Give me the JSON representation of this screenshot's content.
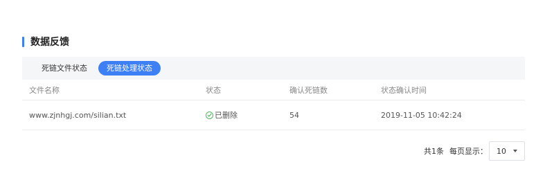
{
  "section": {
    "title": "数据反馈"
  },
  "tabs": [
    {
      "label": "死链文件状态",
      "active": false
    },
    {
      "label": "死链处理状态",
      "active": true
    }
  ],
  "table": {
    "columns": [
      "文件名称",
      "状态",
      "确认死链数",
      "状态确认时间"
    ],
    "rows": [
      {
        "file_name": "www.zjnhgj.com/silian.txt",
        "status": "已删除",
        "confirmed_count": "54",
        "confirmed_time": "2019-11-05 10:42:24"
      }
    ]
  },
  "pagination": {
    "total_text": "共1条",
    "per_page_label": "每页显示：",
    "page_size": "10"
  },
  "colors": {
    "accent": "#3d7ff5",
    "success": "#52b95f"
  },
  "icons": {
    "status": "check-circle-icon",
    "dropdown": "caret-down-icon"
  }
}
